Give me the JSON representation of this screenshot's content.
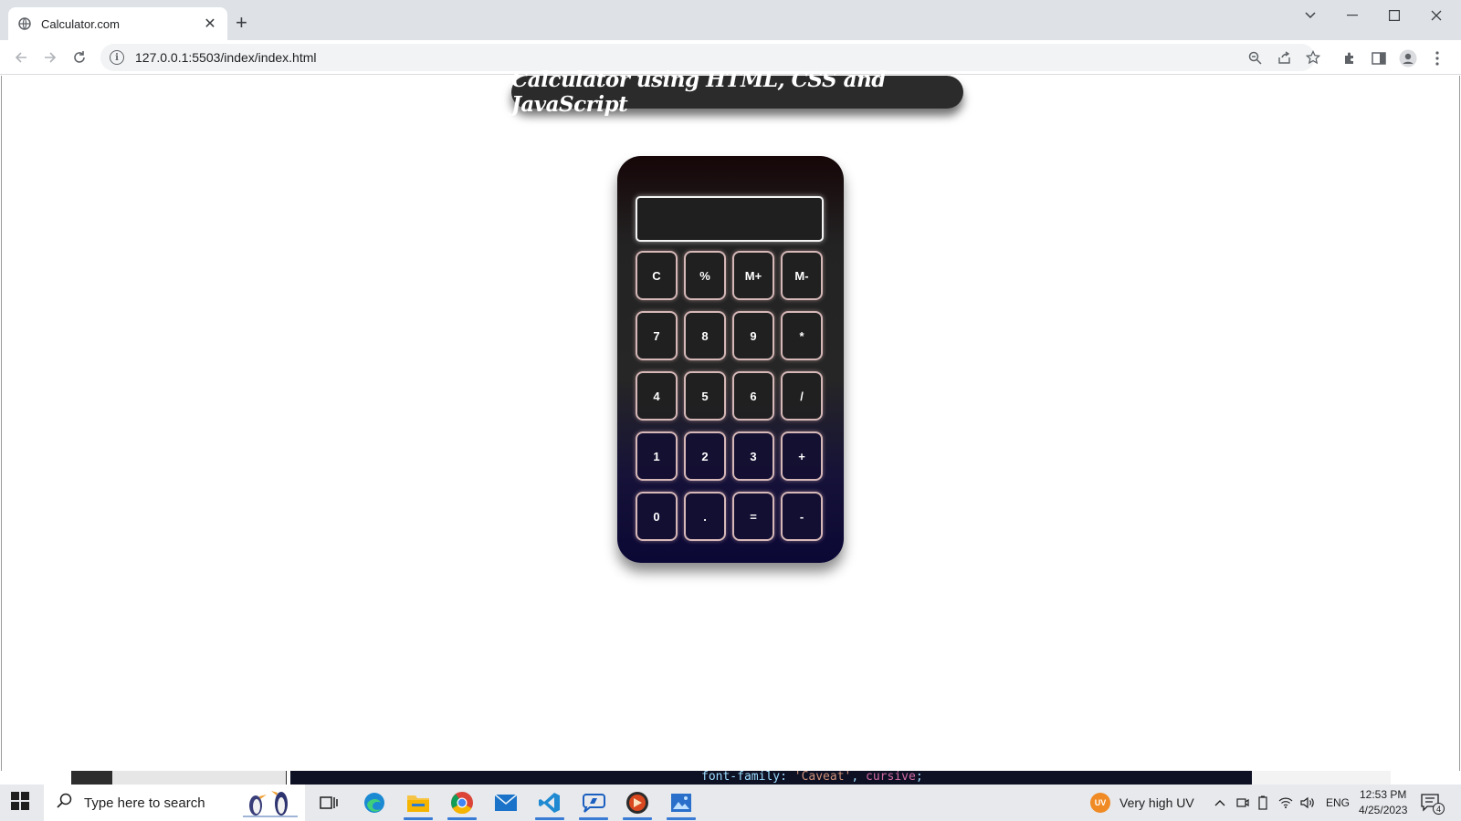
{
  "browser": {
    "tab_title": "Calculator.com",
    "tab_close": "✕",
    "new_tab": "+",
    "url": "127.0.0.1:5503/index/index.html"
  },
  "page": {
    "heading": "Calculator using HTML, CSS and JavaScript"
  },
  "calculator": {
    "display_value": "",
    "rows": [
      [
        {
          "label": "C",
          "name": "clear-button"
        },
        {
          "label": "%",
          "name": "percent-button"
        },
        {
          "label": "M+",
          "name": "memory-add-button"
        },
        {
          "label": "M-",
          "name": "memory-subtract-button"
        }
      ],
      [
        {
          "label": "7",
          "name": "digit-7-button"
        },
        {
          "label": "8",
          "name": "digit-8-button"
        },
        {
          "label": "9",
          "name": "digit-9-button"
        },
        {
          "label": "*",
          "name": "multiply-button"
        }
      ],
      [
        {
          "label": "4",
          "name": "digit-4-button"
        },
        {
          "label": "5",
          "name": "digit-5-button"
        },
        {
          "label": "6",
          "name": "digit-6-button"
        },
        {
          "label": "/",
          "name": "divide-button"
        }
      ],
      [
        {
          "label": "1",
          "name": "digit-1-button"
        },
        {
          "label": "2",
          "name": "digit-2-button"
        },
        {
          "label": "3",
          "name": "digit-3-button"
        },
        {
          "label": "+",
          "name": "add-button"
        }
      ],
      [
        {
          "label": "0",
          "name": "digit-0-button"
        },
        {
          "label": ".",
          "name": "decimal-button"
        },
        {
          "label": "=",
          "name": "equals-button"
        },
        {
          "label": "-",
          "name": "subtract-button"
        }
      ]
    ]
  },
  "background_window": {
    "code_prop": "font-family: ",
    "code_value": "'Caveat'",
    "code_sep": ", ",
    "code_keyword": "cursive",
    "code_end": ";"
  },
  "taskbar": {
    "search_placeholder": "Type here to search",
    "weather": "Very high UV",
    "weather_badge": "UV",
    "language": "ENG",
    "time": "12:53 PM",
    "date": "4/25/2023",
    "notification_count": "4",
    "apps": [
      "task-view-icon",
      "edge-icon",
      "file-explorer-icon",
      "chrome-icon",
      "mail-icon",
      "vscode-icon",
      "app-icon",
      "media-icon",
      "photos-icon"
    ]
  },
  "colors": {
    "calc_top": "#160608",
    "calc_bottom": "#0b0835",
    "button_border": "#d6b8b8",
    "heading_bg": "#2b2b2b"
  }
}
